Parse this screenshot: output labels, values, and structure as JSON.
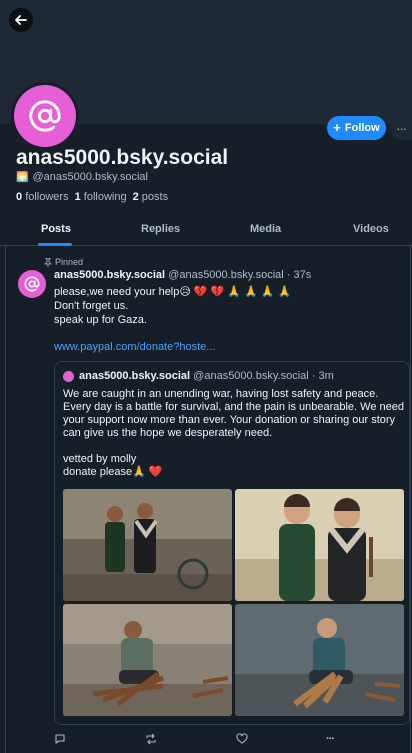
{
  "profile": {
    "display_name": "anas5000.bsky.social",
    "handle": "@anas5000.bsky.social",
    "followers_count": "0",
    "followers_label": "followers",
    "following_count": "1",
    "following_label": "following",
    "posts_count": "2",
    "posts_label": "posts",
    "follow_label": "Follow",
    "more_label": "···"
  },
  "tabs": [
    "Posts",
    "Replies",
    "Media",
    "Videos"
  ],
  "post": {
    "pinned_label": "Pinned",
    "author_name": "anas5000.bsky.social",
    "author_handle": "@anas5000.bsky.social · 37s",
    "text": "please,we need your help😥 💔 💔 🙏 🙏 🙏 🙏\nDon't forget us.\nspeak up for Gaza.",
    "link": "www.paypal.com/donate?hoste..."
  },
  "quote": {
    "author_name": "anas5000.bsky.social",
    "author_handle": "@anas5000.bsky.social · 3m",
    "text": "We are caught in an unending war, having lost safety and peace. Every day is a battle for survival, and the pain is unbearable. We need your support now more than ever. Your donation or sharing our story can give us the hope we desperately need.\n\nvetted by molly\ndonate please🙏 ❤️"
  },
  "images": [
    "two-men-standing-photo",
    "two-men-illustration",
    "man-cutting-wood-photo",
    "man-cutting-wood-illustration"
  ],
  "colors": {
    "accent": "#208bfe",
    "avatar": "#e75fd6",
    "background": "#161e27",
    "link": "#4aa1fe"
  },
  "actions": [
    "reply-icon",
    "repost-icon",
    "like-icon",
    "more-icon"
  ]
}
